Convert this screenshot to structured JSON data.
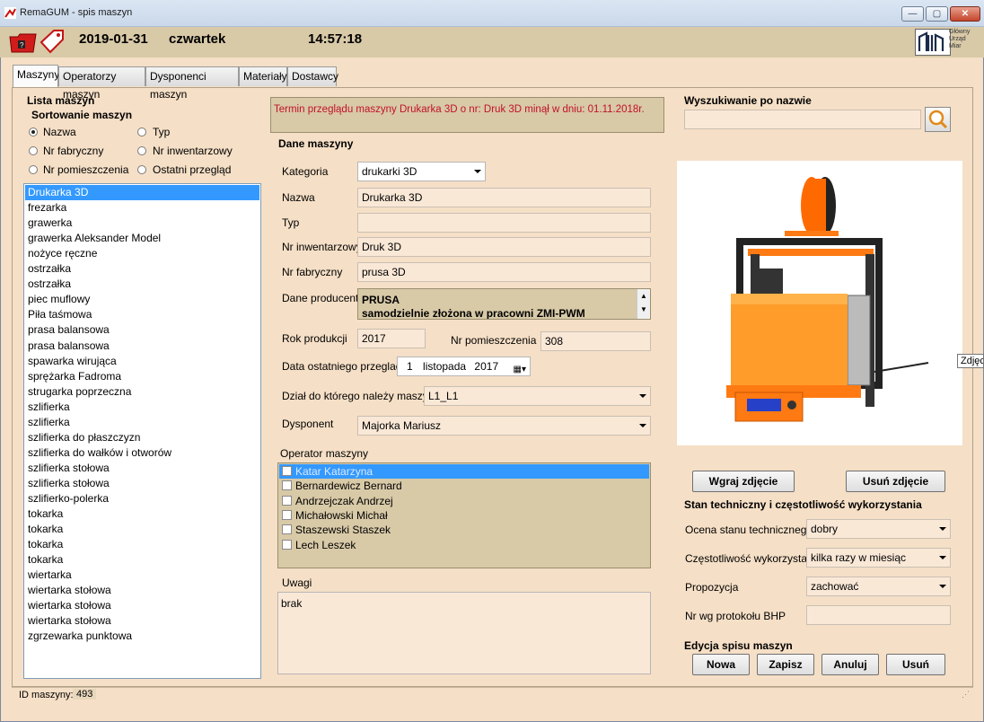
{
  "window": {
    "title": "RemaGUM - spis maszyn"
  },
  "header": {
    "date": "2019-01-31",
    "weekday": "czwartek",
    "time": "14:57:18",
    "logo_lines": [
      "Główny",
      "Urząd",
      "Miar"
    ]
  },
  "tabs": [
    "Maszyny",
    "Operatorzy maszyn",
    "Dysponenci maszyn",
    "Materiały",
    "Dostawcy"
  ],
  "left": {
    "title": "Lista maszyn",
    "sort_title": "Sortowanie maszyn",
    "sort_options": [
      "Nazwa",
      "Typ",
      "Nr fabryczny",
      "Nr inwentarzowy",
      "Nr pomieszczenia",
      "Ostatni przegląd"
    ],
    "selected_sort": "Nazwa",
    "machines": [
      "Drukarka 3D",
      "frezarka",
      "grawerka",
      "grawerka Aleksander Model",
      "nożyce ręczne",
      "ostrzałka",
      "ostrzałka",
      "piec muflowy",
      "Piła taśmowa",
      "prasa balansowa",
      "prasa balansowa",
      "spawarka wirująca",
      "sprężarka Fadroma",
      "strugarka poprzeczna",
      "szlifierka",
      "szlifierka",
      "szlifierka do płaszczyzn",
      "szlifierka do wałków i otworów",
      "szlifierka stołowa",
      "szlifierka stołowa",
      "szlifierko-polerka",
      "tokarka",
      "tokarka",
      "tokarka",
      "tokarka",
      "wiertarka",
      "wiertarka stołowa",
      "wiertarka stołowa",
      "wiertarka stołowa",
      "zgrzewarka punktowa"
    ],
    "selected_machine": "Drukarka 3D"
  },
  "warning": "Termin przeglądu maszyny Drukarka 3D o nr: Druk 3D minął w dniu: 01.11.2018r.",
  "details": {
    "title": "Dane maszyny",
    "category_label": "Kategoria",
    "category_value": "drukarki 3D",
    "name_label": "Nazwa",
    "name_value": "Drukarka 3D",
    "type_label": "Typ",
    "type_value": "",
    "inventory_label": "Nr inwentarzowy",
    "inventory_value": "Druk 3D",
    "serial_label": "Nr fabryczny",
    "serial_value": "prusa 3D",
    "producer_label": "Dane producenta",
    "producer_line1": "PRUSA",
    "producer_line2": "samodzielnie złożona w pracowni ZMI-PWM",
    "year_label": "Rok produkcji",
    "year_value": "2017",
    "room_label": "Nr pomieszczenia",
    "room_value": "308",
    "last_review_label": "Data ostatniego przegladu",
    "last_review_day": "1",
    "last_review_month": "listopada",
    "last_review_year": "2017",
    "dept_label": "Dział do którego należy maszyna",
    "dept_value": "L1_L1",
    "owner_label": "Dysponent",
    "owner_value": "Majorka Mariusz",
    "operators_label": "Operator maszyny",
    "operators": [
      "Katar Katarzyna",
      "Bernardewicz Bernard",
      "Andrzejczak Andrzej",
      "Michałowski Michał",
      "Staszewski Staszek",
      "Lech Leszek"
    ],
    "notes_label": "Uwagi",
    "notes_value": "brak"
  },
  "right": {
    "search_title": "Wyszukiwanie po nazwie",
    "search_value": "",
    "upload_button": "Wgraj zdjęcie",
    "remove_button": "Usuń zdjęcie",
    "tooltip_partial": "Zdjęci",
    "state_title": "Stan techniczny i częstotliwość wykorzystania",
    "tech_label": "Ocena stanu technicznego",
    "tech_value": "dobry",
    "freq_label": "Częstotliwość wykorzystania",
    "freq_value": "kilka razy w miesiąc",
    "prop_label": "Propozycja",
    "prop_value": "zachować",
    "bhp_label": "Nr wg protokołu BHP",
    "bhp_value": "",
    "edit_title": "Edycja spisu maszyn",
    "buttons": [
      "Nowa",
      "Zapisz",
      "Anuluj",
      "Usuń"
    ]
  },
  "status": {
    "label": "ID maszyny:",
    "value": "493"
  }
}
